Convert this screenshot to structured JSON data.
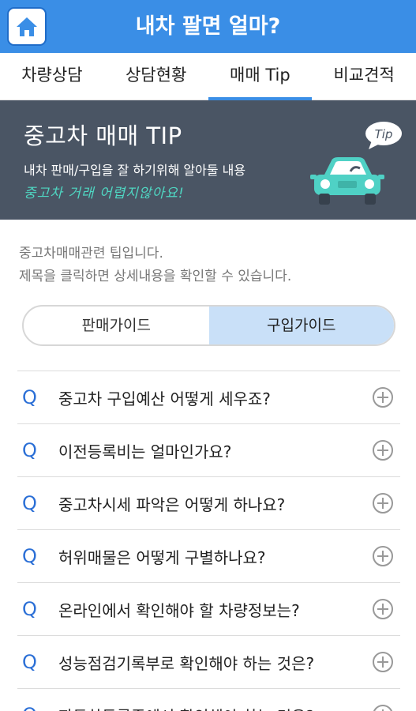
{
  "header": {
    "title": "내차 팔면 얼마?",
    "home_icon": "home-icon"
  },
  "tabs": [
    {
      "label": "차량상담",
      "active": false
    },
    {
      "label": "상담현황",
      "active": false
    },
    {
      "label": "매매 Tip",
      "active": true
    },
    {
      "label": "비교견적",
      "active": false
    }
  ],
  "banner": {
    "title": "중고차 매매 TIP",
    "subtitle": "내차 판매/구입을 잘 하기위해 알아둘 내용",
    "handwriting": "중고차 거래 어렵지않아요!",
    "bubble": "Tip",
    "car_color": "#4fd1c5"
  },
  "intro": {
    "line1": "중고차매매관련 팁입니다.",
    "line2": "제목을 클릭하면 상세내용을 확인할 수 있습니다."
  },
  "segment": {
    "sell": "판매가이드",
    "buy": "구입가이드",
    "active": "buy"
  },
  "faq": [
    {
      "q": "Q",
      "text": "중고차 구입예산 어떻게 세우죠?"
    },
    {
      "q": "Q",
      "text": "이전등록비는 얼마인가요?"
    },
    {
      "q": "Q",
      "text": "중고차시세 파악은 어떻게 하나요?"
    },
    {
      "q": "Q",
      "text": "허위매물은 어떻게 구별하나요?"
    },
    {
      "q": "Q",
      "text": "온라인에서 확인해야 할 차량정보는?"
    },
    {
      "q": "Q",
      "text": "성능점검기록부로 확인해야 하는 것은?"
    },
    {
      "q": "Q",
      "text": "자동차등록증에서 확인해야 하는 것은?"
    }
  ],
  "colors": {
    "accent": "#3a8ee6",
    "banner_bg": "#4a5564",
    "q_color": "#2b6fd6",
    "segment_active": "#c9e0f8"
  }
}
